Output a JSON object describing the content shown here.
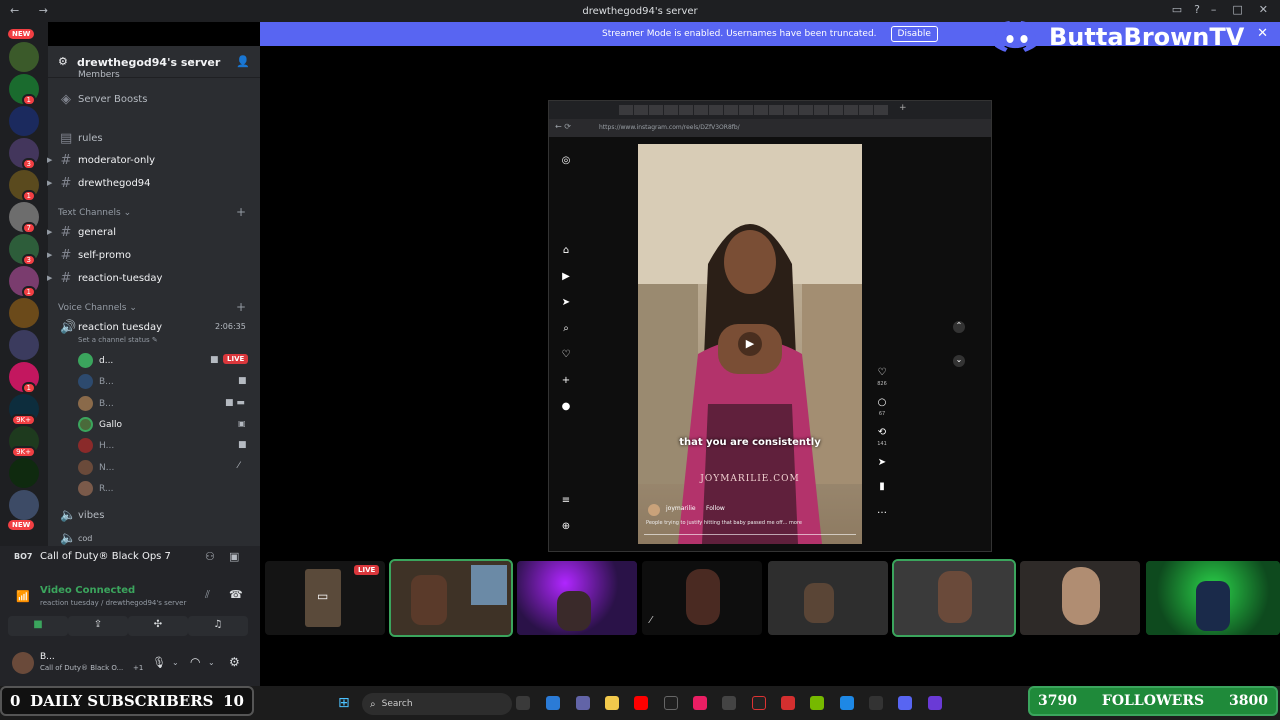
{
  "titlebar": {
    "title": "drewthegod94's server"
  },
  "banner": {
    "text": "Streamer Mode is enabled. Usernames have been truncated.",
    "button": "Disable"
  },
  "brand": {
    "name": "ButtaBrownTV"
  },
  "rail": {
    "badges": [
      "NEW",
      "NEW"
    ]
  },
  "server": {
    "name": "drewthegod94's server"
  },
  "channels": {
    "members_partial": "Members",
    "boosts": "Server Boosts",
    "rules": "rules",
    "moderator_only": "moderator-only",
    "drewthegod94": "drewthegod94",
    "text_category": "Text Channels",
    "general": "general",
    "self_promo": "self-promo",
    "reaction_tuesday": "reaction-tuesday",
    "voice_category": "Voice Channels",
    "voice_channel": "reaction tuesday",
    "voice_timer": "2:06:35",
    "voice_status": "Set a channel status",
    "vibes": "vibes",
    "cod": "cod"
  },
  "voice_users": [
    {
      "name": "d...",
      "live": "LIVE"
    },
    {
      "name": "B..."
    },
    {
      "name": "B..."
    },
    {
      "name": "Gallo"
    },
    {
      "name": "H..."
    },
    {
      "name": "N..."
    },
    {
      "name": "R..."
    }
  ],
  "activity": {
    "game": "Call of Duty® Black Ops 7"
  },
  "voice_connection": {
    "status": "Video Connected",
    "channel": "reaction tuesday / drewthegod94's server"
  },
  "user": {
    "name": "B...",
    "activity": "Call of Duty® Black O...",
    "extra": "+1"
  },
  "browser": {
    "url": "https://www.instagram.com/reels/DZfV3OR8fb/"
  },
  "reel": {
    "caption": "that you are consistently",
    "watermark": "JOYMARILIE.COM",
    "account": "joymarilie",
    "follow": "Follow",
    "description": "People trying to justify hitting that baby passed me off... more",
    "likes": "826",
    "comments": "67",
    "reposts": "141"
  },
  "stream_tiles": {
    "live": "LIVE"
  },
  "taskbar": {
    "search": "Search"
  },
  "overlay_subs": {
    "left": "0",
    "label": "DAILY SUBSCRIBERS",
    "right": "10"
  },
  "overlay_followers": {
    "left": "3790",
    "label": "FOLLOWERS",
    "right": "3800"
  },
  "colors": {
    "blurple": "#5865f2",
    "live_red": "#da373c",
    "green": "#3ba55d",
    "sidebar": "#2b2d31",
    "rail": "#1e1f22"
  }
}
